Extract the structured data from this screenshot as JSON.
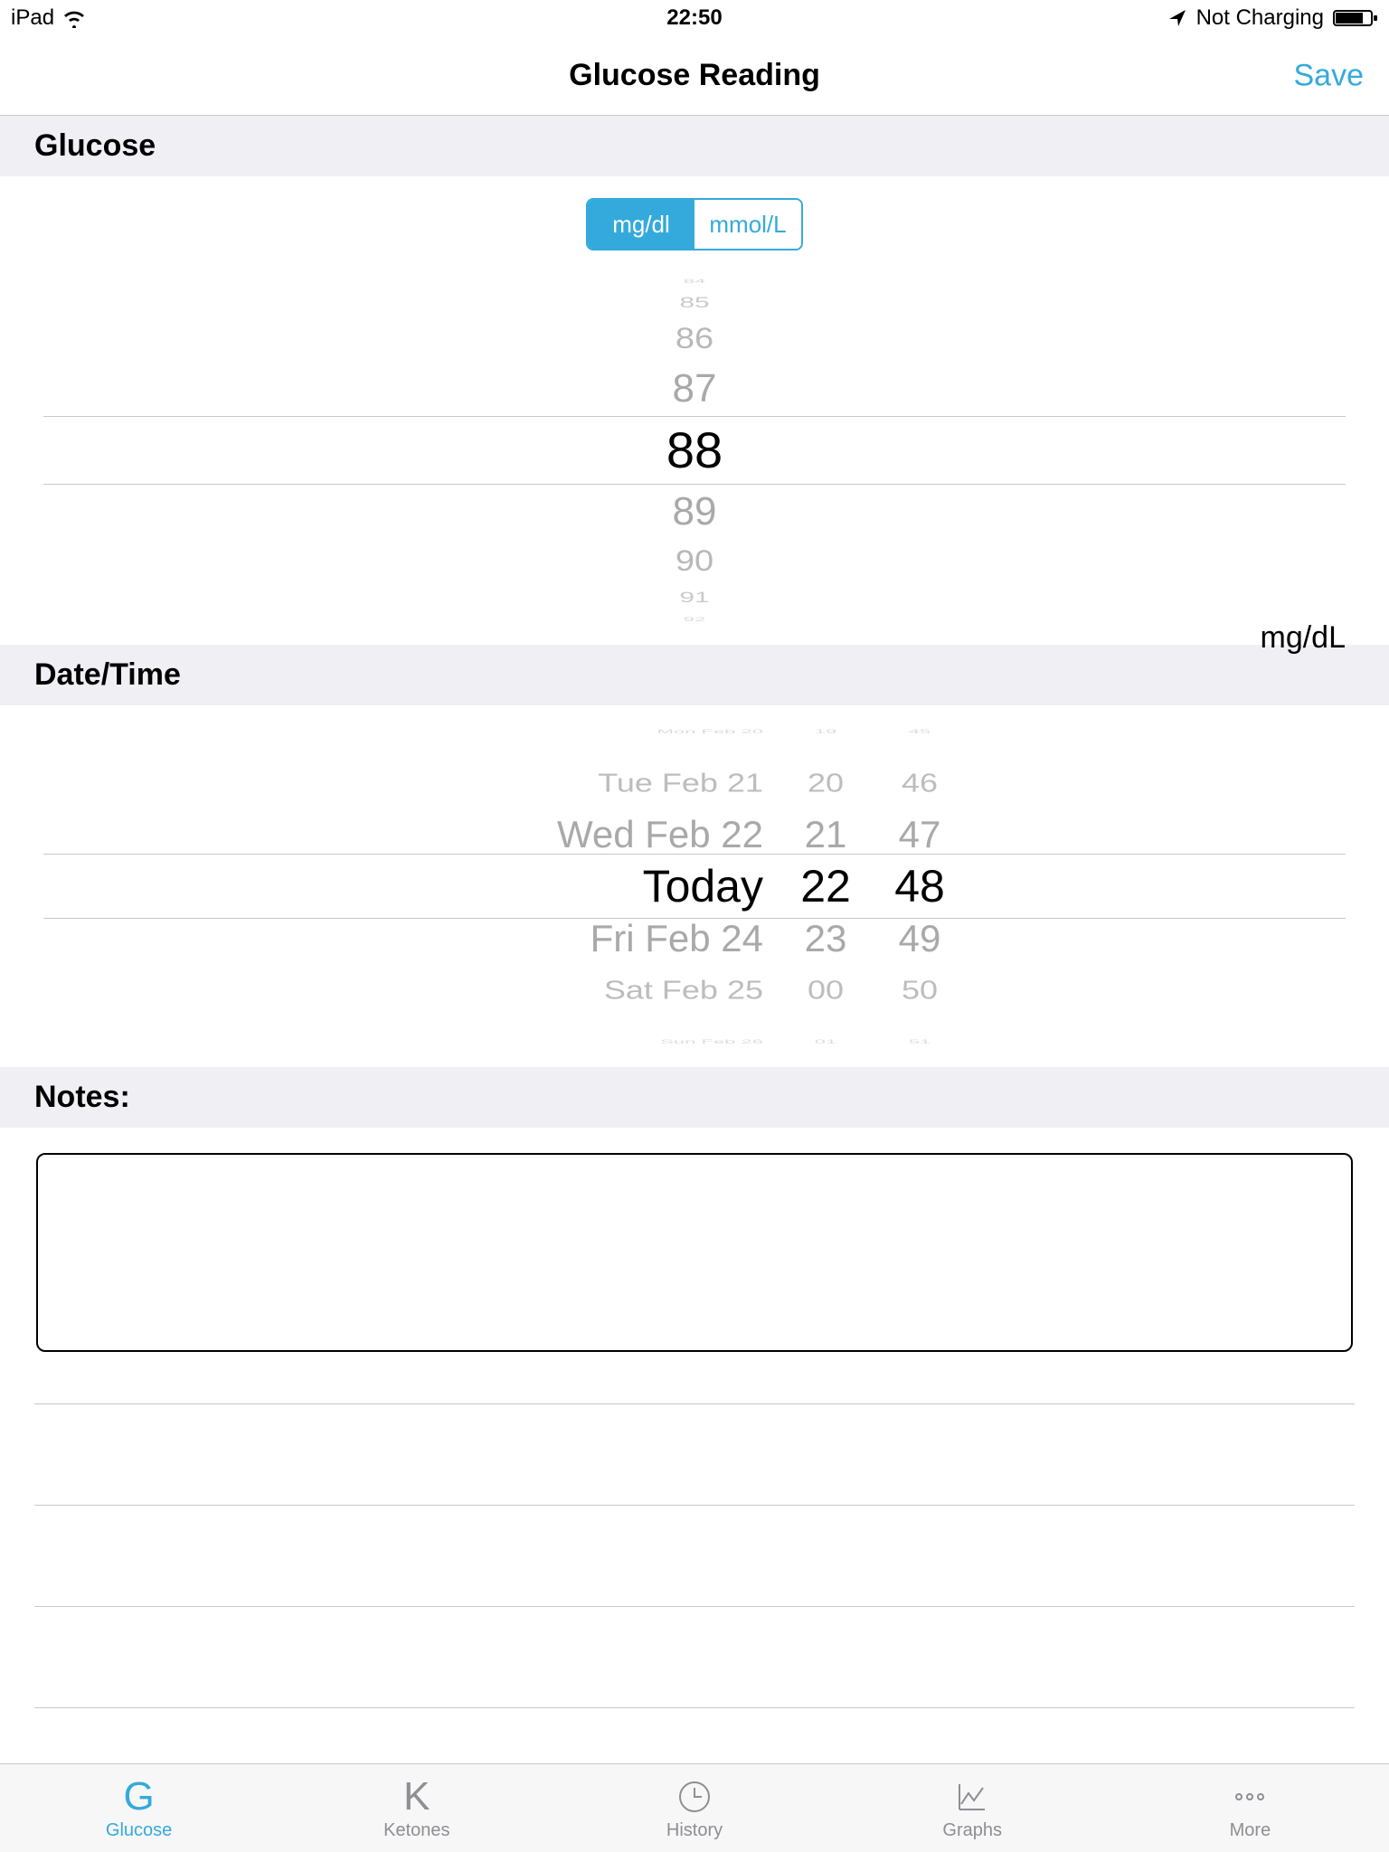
{
  "status": {
    "device": "iPad",
    "time": "22:50",
    "charging": "Not Charging"
  },
  "nav": {
    "title": "Glucose Reading",
    "save": "Save"
  },
  "sections": {
    "glucose": "Glucose",
    "datetime": "Date/Time",
    "notes": "Notes:"
  },
  "unitToggle": {
    "left": "mg/dl",
    "right": "mmol/L"
  },
  "valuePicker": {
    "v84": "84",
    "v85": "85",
    "v86": "86",
    "v87": "87",
    "selected": "88",
    "v89": "89",
    "v90": "90",
    "v91": "91",
    "v92": "92",
    "unit": "mg/dL"
  },
  "datePicker": {
    "rows": [
      {
        "day": "Mon Feb 20",
        "hr": "19",
        "min": "45"
      },
      {
        "day": "Tue Feb 21",
        "hr": "20",
        "min": "46"
      },
      {
        "day": "Wed Feb 22",
        "hr": "21",
        "min": "47"
      },
      {
        "day": "Today",
        "hr": "22",
        "min": "48"
      },
      {
        "day": "Fri Feb 24",
        "hr": "23",
        "min": "49"
      },
      {
        "day": "Sat Feb 25",
        "hr": "00",
        "min": "50"
      },
      {
        "day": "Sun Feb 26",
        "hr": "01",
        "min": "51"
      }
    ]
  },
  "tabs": {
    "glucose": "Glucose",
    "ketones": "Ketones",
    "history": "History",
    "graphs": "Graphs",
    "more": "More"
  }
}
